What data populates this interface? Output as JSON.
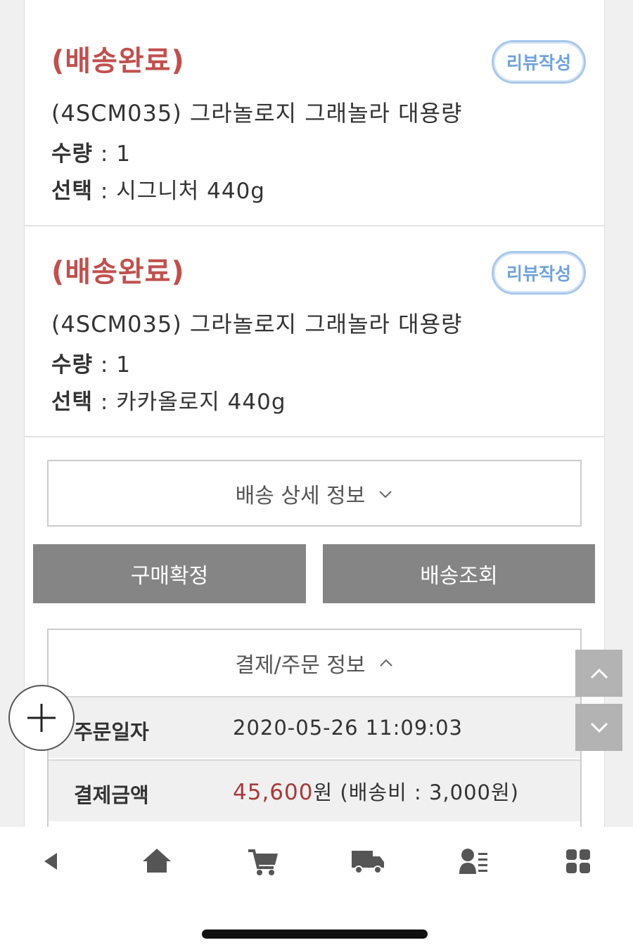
{
  "order_items": [
    {
      "status": "(배송완료)",
      "review_label": "리뷰작성",
      "product": "(4SCM035) 그라놀로지 그래놀라 대용량",
      "qty_label": "수량",
      "qty_value": ": 1",
      "option_label": "선택",
      "option_value": ": 시그니처 440g"
    },
    {
      "status": "(배송완료)",
      "review_label": "리뷰작성",
      "product": "(4SCM035) 그라놀로지 그래놀라 대용량",
      "qty_label": "수량",
      "qty_value": ": 1",
      "option_label": "선택",
      "option_value": ": 카카올로지 440g"
    }
  ],
  "delivery_detail_label": "배송 상세 정보",
  "buttons": {
    "confirm_purchase": "구매확정",
    "track_delivery": "배송조회"
  },
  "payment": {
    "header": "결제/주문 정보",
    "order_date_label": "주문일자",
    "order_date_value": "2020-05-26 11:09:03",
    "amount_label": "결제금액",
    "amount_value": "45,600",
    "amount_unit": "원",
    "shipping_note": "(배송비 : 3,000원)"
  },
  "colors": {
    "status_red": "#c0504d",
    "review_blue": "#6fa3dc",
    "button_gray": "#858585",
    "price_red": "#a83a3a"
  },
  "nav_icons": [
    "back-icon",
    "home-icon",
    "cart-icon",
    "truck-icon",
    "user-list-icon",
    "grid-menu-icon"
  ]
}
